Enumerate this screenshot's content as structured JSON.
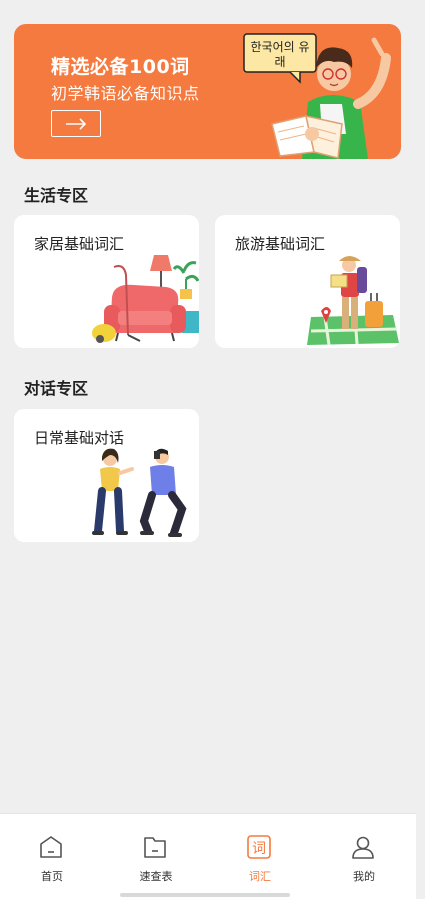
{
  "banner": {
    "title": "精选必备100词",
    "subtitle": "初学韩语必备知识点",
    "bubble_text": "한국어의 유래",
    "button_icon": "arrow-right-icon",
    "accent": "#f47a3f"
  },
  "sections": {
    "life": {
      "title": "生活专区",
      "cards": [
        {
          "label": "家居基础词汇",
          "illustration": "sofa-illustration"
        },
        {
          "label": "旅游基础词汇",
          "illustration": "traveler-illustration"
        }
      ]
    },
    "dialogue": {
      "title": "对话专区",
      "cards": [
        {
          "label": "日常基础对话",
          "illustration": "people-chatting-illustration"
        }
      ]
    }
  },
  "tabbar": {
    "items": [
      {
        "label": "首页",
        "icon": "home-icon",
        "active": false
      },
      {
        "label": "速查表",
        "icon": "folder-icon",
        "active": false
      },
      {
        "label": "词汇",
        "icon": "vocab-icon",
        "active": true
      },
      {
        "label": "我的",
        "icon": "user-icon",
        "active": false
      }
    ],
    "active_color": "#f47a3f"
  }
}
